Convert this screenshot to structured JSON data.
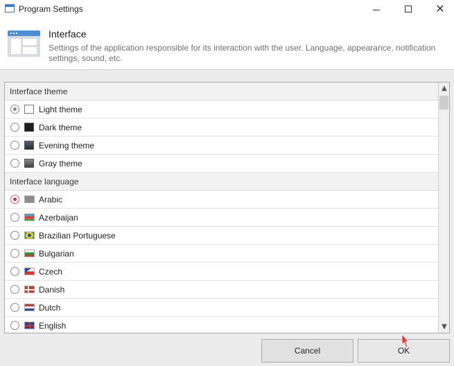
{
  "window": {
    "title": "Program Settings"
  },
  "header": {
    "title": "Interface",
    "description": "Settings of the application responsible for its interaction with the user. Language, appearance, notification settings, sound, etc."
  },
  "groups": [
    {
      "label": "Interface theme",
      "items": [
        {
          "label": "Light theme",
          "swatch": "#ffffff",
          "checked": true
        },
        {
          "label": "Dark theme",
          "swatch": "#1e1e1e",
          "checked": false
        },
        {
          "label": "Evening theme",
          "swatch": "#3a3f47",
          "checked": false
        },
        {
          "label": "Gray theme",
          "swatch": "#5a5a5a",
          "checked": false
        }
      ]
    },
    {
      "label": "Interface language",
      "items": [
        {
          "label": "Arabic",
          "flag": "arabic-flag-icon",
          "checked": true
        },
        {
          "label": "Azerbaijan",
          "flag": "azerbaijan-flag-icon",
          "checked": false
        },
        {
          "label": "Brazilian Portuguese",
          "flag": "brazil-flag-icon",
          "checked": false
        },
        {
          "label": "Bulgarian",
          "flag": "bulgaria-flag-icon",
          "checked": false
        },
        {
          "label": "Czech",
          "flag": "czech-flag-icon",
          "checked": false
        },
        {
          "label": "Danish",
          "flag": "denmark-flag-icon",
          "checked": false
        },
        {
          "label": "Dutch",
          "flag": "netherlands-flag-icon",
          "checked": false
        },
        {
          "label": "English",
          "flag": "uk-flag-icon",
          "checked": false
        }
      ]
    }
  ],
  "buttons": {
    "cancel": "Cancel",
    "ok": "OK"
  },
  "colors": {
    "accent": "#4a8fd8",
    "focus_ring": "#e0555f"
  }
}
